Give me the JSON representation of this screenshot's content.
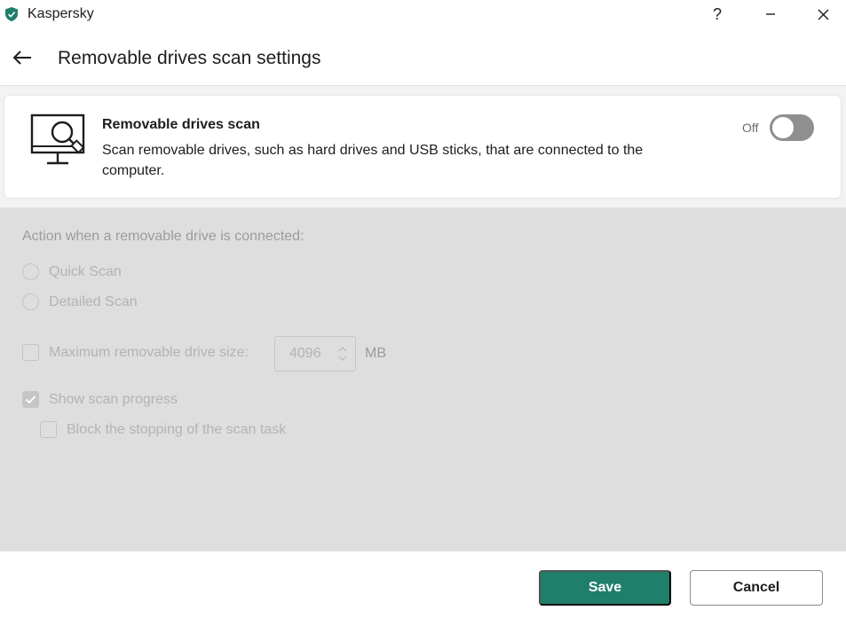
{
  "window": {
    "app_title": "Kaspersky",
    "help_label": "?",
    "accent_color": "#1f7f6b"
  },
  "header": {
    "page_title": "Removable drives scan settings"
  },
  "feature": {
    "title": "Removable drives scan",
    "description": "Scan removable drives, such as hard drives and USB sticks, that are connected to the computer.",
    "toggle_state_label": "Off",
    "enabled": false,
    "icon": "monitor-search-icon"
  },
  "settings": {
    "section_label": "Action when a removable drive is connected:",
    "options": [
      {
        "label": "Quick Scan",
        "selected": false
      },
      {
        "label": "Detailed Scan",
        "selected": false
      }
    ],
    "max_size": {
      "label": "Maximum removable drive size:",
      "value": "4096",
      "unit": "MB",
      "checked": false
    },
    "show_progress": {
      "label": "Show scan progress",
      "checked": true
    },
    "block_stopping": {
      "label": "Block the stopping of the scan task",
      "checked": false
    }
  },
  "footer": {
    "save_label": "Save",
    "cancel_label": "Cancel"
  }
}
